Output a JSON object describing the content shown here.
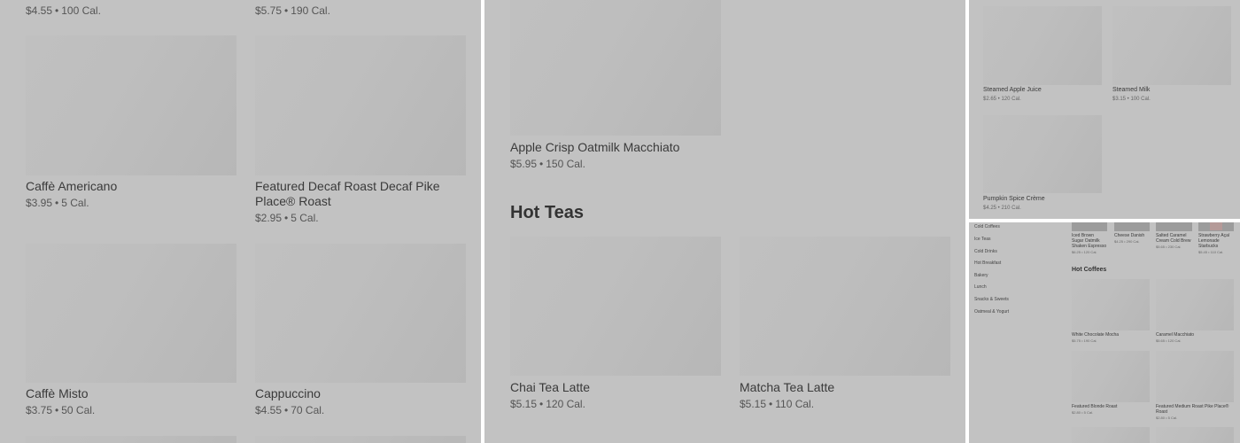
{
  "panel1": {
    "top_items": [
      {
        "price": "$4.55",
        "cal": "100 Cal."
      },
      {
        "price": "$5.75",
        "cal": "190 Cal."
      }
    ],
    "items": [
      {
        "name": "Caffè Americano",
        "price": "$3.95",
        "cal": "5 Cal."
      },
      {
        "name": "Featured Decaf Roast Decaf Pike",
        "name2": "Place® Roast",
        "price": "$2.95",
        "cal": "5 Cal."
      },
      {
        "name": "Caffè Misto",
        "price": "$3.75",
        "cal": "50 Cal."
      },
      {
        "name": "Cappuccino",
        "price": "$4.55",
        "cal": "70 Cal."
      }
    ]
  },
  "panel2": {
    "top_item": {
      "name": "Apple Crisp Oatmilk Macchiato",
      "price": "$5.95",
      "cal": "150 Cal."
    },
    "section_title": "Hot Teas",
    "items": [
      {
        "name": "Chai Tea Latte",
        "price": "$5.15",
        "cal": "120 Cal."
      },
      {
        "name": "Matcha Tea Latte",
        "price": "$5.15",
        "cal": "110 Cal."
      }
    ]
  },
  "panel3": {
    "items": [
      {
        "name": "Steamed Apple Juice",
        "price": "$2.65",
        "cal": "120 Cal."
      },
      {
        "name": "Steamed Milk",
        "price": "$3.15",
        "cal": "100 Cal."
      },
      {
        "name": "Pumpkin Spice Crème",
        "price": "$4.25",
        "cal": "210 Cal."
      }
    ]
  },
  "panel4": {
    "sidebar": [
      "Cold Coffees",
      "Ice Teas",
      "Cold Drinks",
      "Hot Breakfast",
      "Bakery",
      "Lunch",
      "Snacks & Sweets",
      "Oatmeal & Yogurt"
    ],
    "top_items": [
      {
        "name": [
          "Iced Brown",
          "Sugar Oatmilk",
          "Shaken Espresso"
        ],
        "price": "$6.25",
        "cal": "120 Cal."
      },
      {
        "name": [
          "Cheese Danish"
        ],
        "price": "$4.25",
        "cal": "290 Cal."
      },
      {
        "name": [
          "Salted Caramel",
          "Cream Cold Brew"
        ],
        "price": "$5.65",
        "cal": "230 Cal."
      },
      {
        "name": [
          "Strawberry Açaí",
          "Lemonade",
          "Starbucks"
        ],
        "price": "$5.45",
        "cal": "110 Cal."
      }
    ],
    "section_title": "Hot Coffees",
    "items": [
      {
        "name": [
          "White Chocolate Mocha"
        ],
        "price": "$5.75",
        "cal": "190 Cal."
      },
      {
        "name": [
          "Caramel Macchiato"
        ],
        "price": "$5.65",
        "cal": "120 Cal."
      },
      {
        "name": [
          "Featured Blonde Roast"
        ],
        "price": "$2.80",
        "cal": "5 Cal."
      },
      {
        "name": [
          "Featured Medium Roast Pike Place®",
          "Roast"
        ],
        "price": "$2.80",
        "cal": "5 Cal."
      }
    ]
  }
}
